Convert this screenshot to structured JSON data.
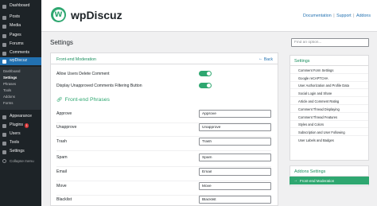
{
  "colors": {
    "accent": "#2ea770",
    "link": "#2271b1",
    "admin_bg": "#1d2327",
    "admin_active": "#2271b1"
  },
  "wp_menu": {
    "items": [
      {
        "label": "Dashboard",
        "icon": "dashboard-icon"
      },
      {
        "label": "Posts",
        "icon": "posts-icon"
      },
      {
        "label": "Media",
        "icon": "media-icon"
      },
      {
        "label": "Pages",
        "icon": "pages-icon"
      },
      {
        "label": "Forums",
        "icon": "forums-icon"
      },
      {
        "label": "Comments",
        "icon": "comments-icon"
      },
      {
        "label": "wpDiscuz",
        "icon": "wpdiscuz-icon"
      }
    ],
    "submenu": [
      "Dashboard",
      "Settings",
      "Phrases",
      "Tools",
      "Addons",
      "Forms"
    ],
    "items_after": [
      {
        "label": "Appearance",
        "icon": "appearance-icon"
      },
      {
        "label": "Plugins",
        "icon": "plugins-icon",
        "badge": "1"
      },
      {
        "label": "Users",
        "icon": "users-icon"
      },
      {
        "label": "Tools",
        "icon": "tools-icon"
      },
      {
        "label": "Settings",
        "icon": "settings-icon"
      }
    ],
    "collapse": "Collapse menu"
  },
  "header": {
    "logo_letter": "W",
    "title": "wpDiscuz",
    "links": [
      "Documentation",
      "Support",
      "Addons"
    ]
  },
  "page": {
    "title": "Settings",
    "search_placeholder": "Find an option..."
  },
  "panel": {
    "title": "Front-end Moderation",
    "back_label": "Back",
    "options": [
      {
        "label": "Allow Users Delete Comment",
        "enabled": true
      },
      {
        "label": "Display Unapproved Comments Filtering Button",
        "enabled": true
      }
    ],
    "phrases_title": "Front-end Phrases",
    "phrases": [
      {
        "label": "Approve",
        "value": "Approve"
      },
      {
        "label": "Unapprove",
        "value": "Unapprove"
      },
      {
        "label": "Trash",
        "value": "Trash"
      },
      {
        "label": "Spam",
        "value": "Spam"
      },
      {
        "label": "Email",
        "value": "Email"
      },
      {
        "label": "Move",
        "value": "Move"
      },
      {
        "label": "Blacklist",
        "value": "Blacklist"
      }
    ]
  },
  "settings_nav": {
    "title": "Settings",
    "items": [
      "Comment Form Settings",
      "Google reCAPTCHA",
      "User Authorization and Profile Data",
      "Social Login and Share",
      "Article and Comment Rating",
      "Comment Thread Displaying",
      "Comment Thread Features",
      "Styles and Colors",
      "Subscription and User Following",
      "User Labels and Badges"
    ]
  },
  "addons_nav": {
    "title": "Addons Settings",
    "items": [
      {
        "label": "Front-end Moderation",
        "active": true
      }
    ]
  }
}
